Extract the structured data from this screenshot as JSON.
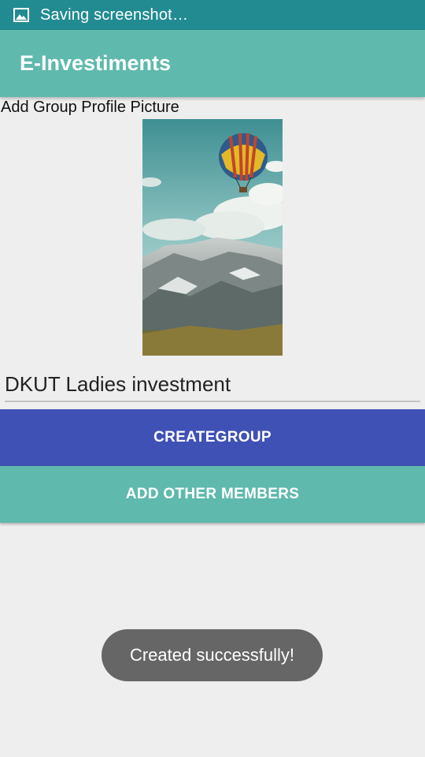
{
  "status_bar": {
    "icon": "image-icon",
    "text": "Saving screenshot…"
  },
  "app_bar": {
    "title": "E-Investiments"
  },
  "form": {
    "profile_picture_label": "Add Group Profile Picture",
    "profile_picture": "hot-air-balloon-over-mountains",
    "group_name_value": "DKUT Ladies investment"
  },
  "buttons": {
    "create_group": "CREATEGROUP",
    "add_members": "ADD OTHER MEMBERS"
  },
  "toast": {
    "message": "Created successfully!"
  },
  "colors": {
    "status_bar": "#228b92",
    "app_bar": "#5fb9ad",
    "create_button": "#3f51b5",
    "add_button": "#5fb9ad",
    "toast": "#666666"
  }
}
